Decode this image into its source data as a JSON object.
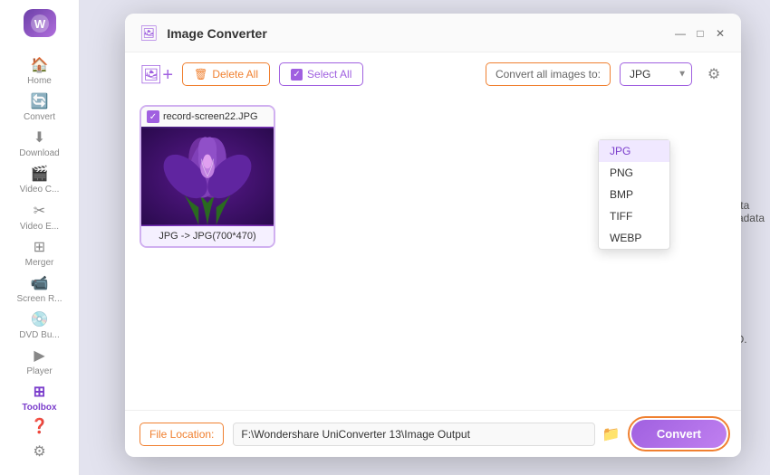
{
  "sidebar": {
    "logo": "W",
    "items": [
      {
        "id": "home",
        "label": "Home",
        "icon": "🏠",
        "active": false
      },
      {
        "id": "convert",
        "label": "Convert",
        "icon": "🔄",
        "active": false
      },
      {
        "id": "download",
        "label": "Download",
        "icon": "⬇",
        "active": false
      },
      {
        "id": "video-c",
        "label": "Video C...",
        "icon": "🎬",
        "active": false
      },
      {
        "id": "video-e",
        "label": "Video E...",
        "icon": "✂",
        "active": false
      },
      {
        "id": "merger",
        "label": "Merger",
        "icon": "⊞",
        "active": false
      },
      {
        "id": "screen-r",
        "label": "Screen R...",
        "icon": "📹",
        "active": false
      },
      {
        "id": "dvd-bu",
        "label": "DVD Bu...",
        "icon": "💿",
        "active": false
      },
      {
        "id": "player",
        "label": "Player",
        "icon": "▶",
        "active": false
      },
      {
        "id": "toolbox",
        "label": "Toolbox",
        "icon": "⊞",
        "active": true
      }
    ],
    "bottom": [
      {
        "id": "help",
        "icon": "❓"
      },
      {
        "id": "settings",
        "icon": "⚙"
      }
    ]
  },
  "modal": {
    "title": "Image Converter",
    "toolbar": {
      "delete_label": "Delete All",
      "select_label": "Select All",
      "convert_all_label": "Convert all images to:",
      "selected_format": "JPG"
    },
    "formats": [
      "JPG",
      "PNG",
      "BMP",
      "TIFF",
      "WEBP"
    ],
    "images": [
      {
        "filename": "record-screen22.JPG",
        "caption": "JPG -> JPG(700*470)",
        "checked": true
      }
    ],
    "footer": {
      "file_location_label": "File Location:",
      "path_value": "F:\\Wondershare UniConverter 13\\Image Output",
      "convert_btn_label": "Convert"
    },
    "window_controls": {
      "minimize": "—",
      "maximize": "□",
      "close": "✕"
    }
  },
  "right_panel": {
    "text1": "data",
    "text2": "etadata",
    "text3": "CD."
  }
}
